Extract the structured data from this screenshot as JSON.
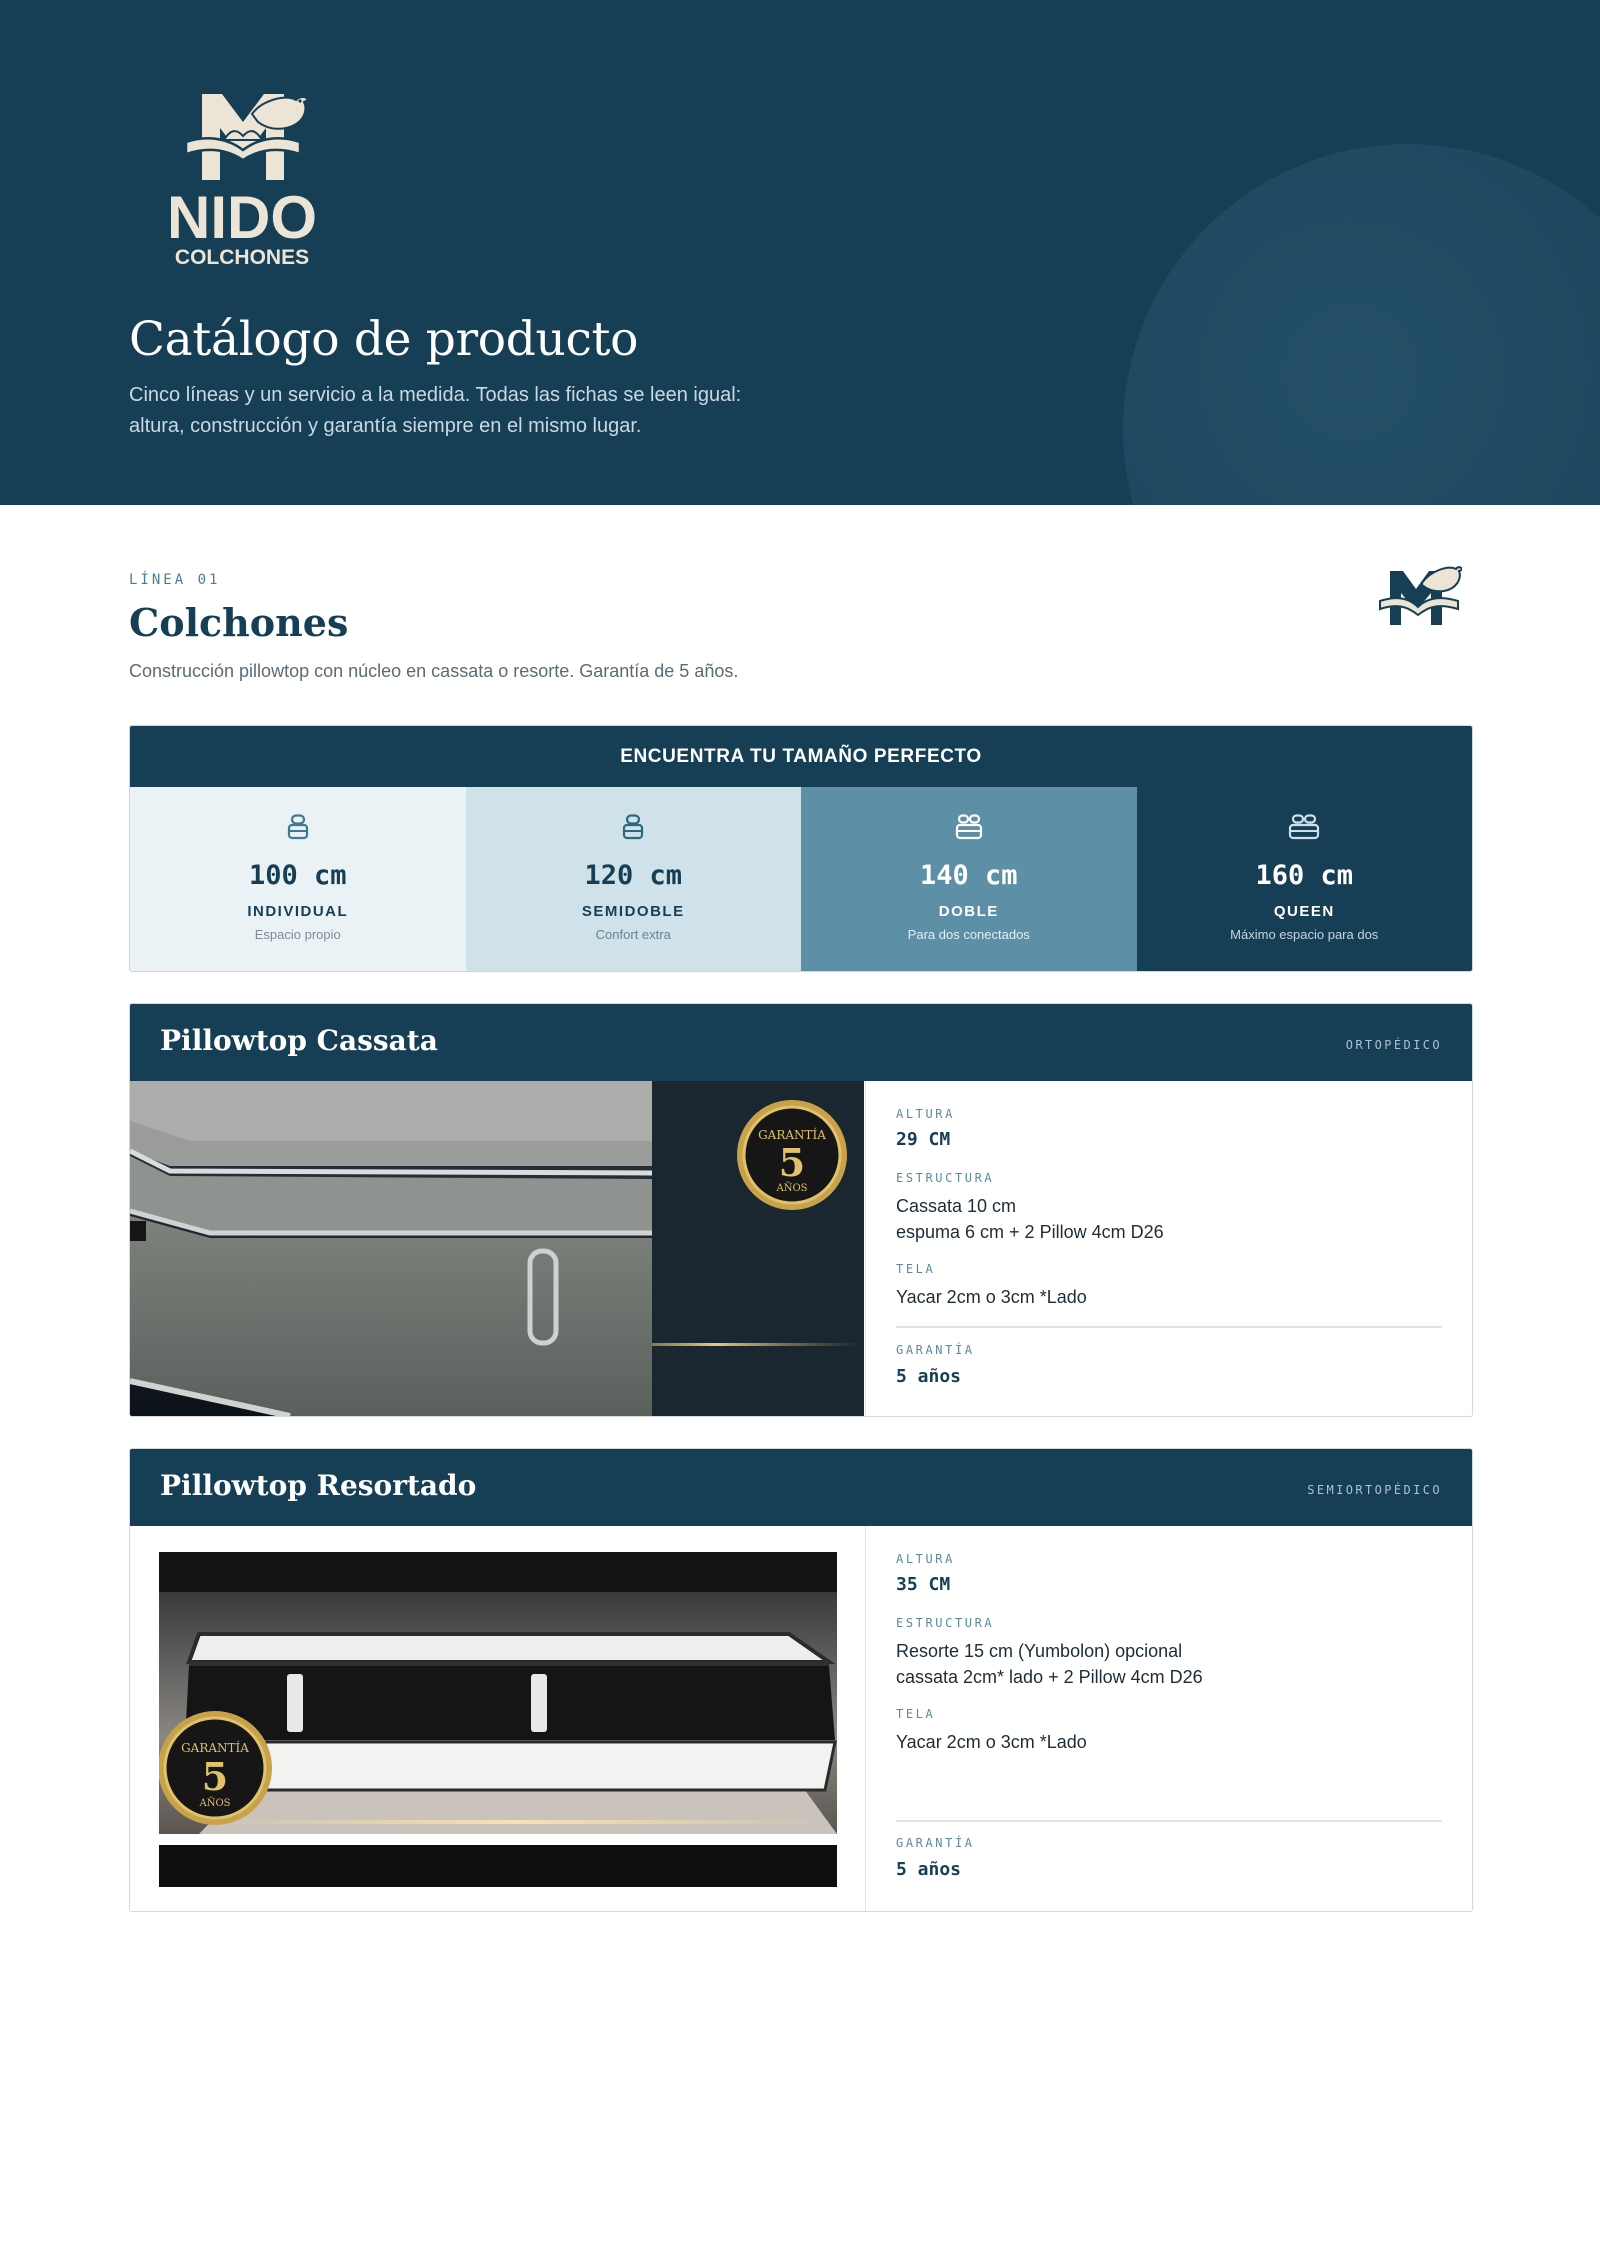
{
  "brand": {
    "name": "NIDO",
    "sub": "COLCHONES"
  },
  "hero": {
    "title": "Catálogo de producto",
    "subtitle_line1": "Cinco líneas y un servicio a la medida. Todas las fichas se leen igual:",
    "subtitle_line2": "altura, construcción y garantía siempre en el mismo lugar."
  },
  "section": {
    "eyebrow": "LÍNEA 01",
    "title": "Colchones",
    "description": "Construcción pillowtop con núcleo en cassata o resorte. Garantía de 5 años."
  },
  "size_guide": {
    "heading": "ENCUENTRA TU TAMAÑO PERFECTO",
    "sizes": [
      {
        "cm": "100 cm",
        "name": "INDIVIDUAL",
        "desc": "Espacio propio",
        "icon": "single-bed-icon"
      },
      {
        "cm": "120 cm",
        "name": "SEMIDOBLE",
        "desc": "Confort extra",
        "icon": "single-bed-icon"
      },
      {
        "cm": "140 cm",
        "name": "DOBLE",
        "desc": "Para dos conectados",
        "icon": "double-bed-icon"
      },
      {
        "cm": "160 cm",
        "name": "QUEEN",
        "desc": "Máximo espacio para dos",
        "icon": "double-bed-icon"
      }
    ]
  },
  "products": [
    {
      "title": "Pillowtop Cassata",
      "tag": "ORTOPÉDICO",
      "altura_label": "ALTURA",
      "altura": "29 CM",
      "estructura_label": "ESTRUCTURA",
      "estructura_line1": "Cassata 10 cm",
      "estructura_line2": "espuma 6 cm + 2 Pillow 4cm D26",
      "tela_label": "TELA",
      "tela": "Yacar 2cm o 3cm *Lado",
      "garantia_label": "GARANTÍA",
      "garantia": "5 años",
      "badge": {
        "top": "GARANTÍA",
        "number": "5",
        "bottom": "AÑOS"
      }
    },
    {
      "title": "Pillowtop Resortado",
      "tag": "SEMIORTOPÉDICO",
      "altura_label": "ALTURA",
      "altura": "35 CM",
      "estructura_label": "ESTRUCTURA",
      "estructura_line1": "Resorte 15 cm (Yumbolon) opcional",
      "estructura_line2": "cassata 2cm* lado + 2 Pillow 4cm D26",
      "tela_label": "TELA",
      "tela": "Yacar 2cm o 3cm *Lado",
      "garantia_label": "GARANTÍA",
      "garantia": "5 años",
      "badge": {
        "top": "GARANTÍA",
        "number": "5",
        "bottom": "AÑOS"
      }
    }
  ],
  "colors": {
    "primary": "#163f56",
    "accent": "#5d90a7",
    "cream": "#ece4d4",
    "gold": "#c8a24a"
  }
}
